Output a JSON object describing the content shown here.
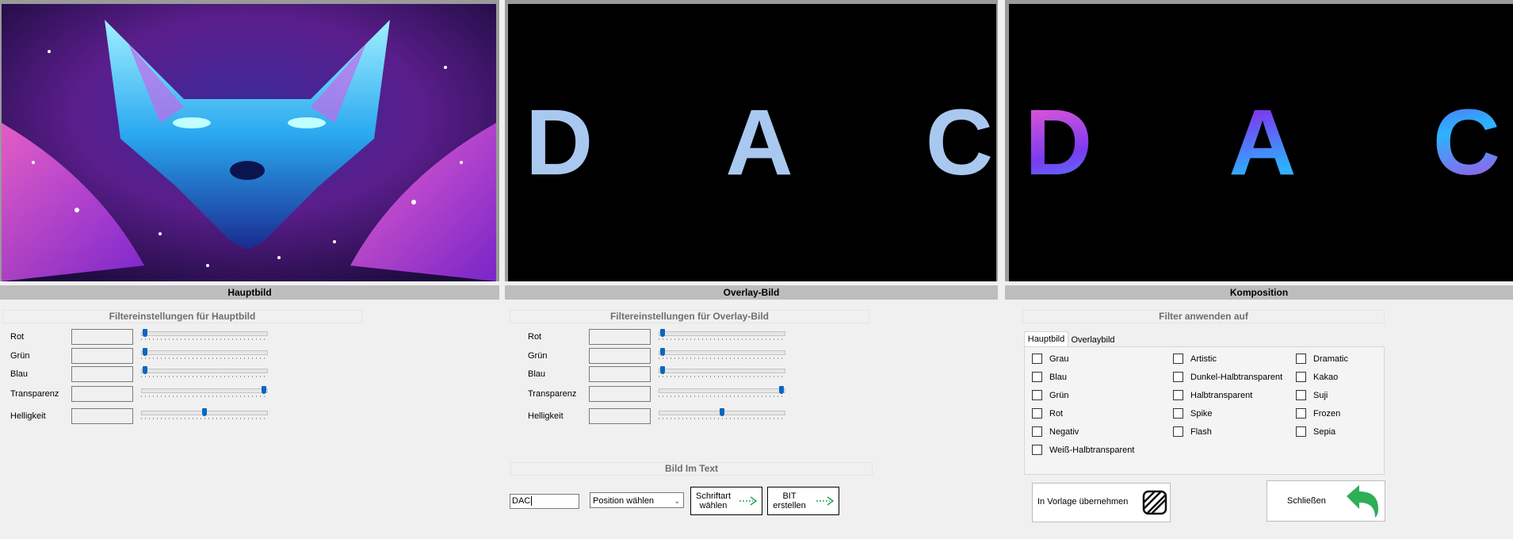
{
  "panels": {
    "main_caption": "Hauptbild",
    "overlay_caption": "Overlay-Bild",
    "composition_caption": "Komposition",
    "overlay_text": "DAC",
    "composition_text": "DAC"
  },
  "main_filter": {
    "header": "Filtereinstellungen für Hauptbild",
    "labels": [
      "Rot",
      "Grün",
      "Blau",
      "Transparenz",
      "Helligkeit"
    ],
    "levels": [
      0,
      0,
      0,
      1.0,
      0.5
    ]
  },
  "overlay_filter": {
    "header": "Filtereinstellungen für Overlay-Bild",
    "labels": [
      "Rot",
      "Grün",
      "Blau",
      "Transparenz",
      "Helligkeit"
    ],
    "levels": [
      0,
      0,
      0,
      1.0,
      0.5
    ]
  },
  "text_image": {
    "header": "Bild Im Text",
    "text_value": "DAC",
    "position_select": "Position wählen",
    "font_button": [
      "Schriftart",
      "wählen"
    ],
    "bit_button": [
      "BIT",
      "erstellen"
    ]
  },
  "apply_filter": {
    "header": "Filter anwenden auf",
    "tabs": [
      "Hauptbild",
      "Overlaybild"
    ],
    "active_tab": "Hauptbild",
    "col1": [
      "Grau",
      "Blau",
      "Grün",
      "Rot",
      "Negativ",
      "Weiß-Halbtransparent"
    ],
    "col2": [
      "Artistic",
      "Dunkel-Halbtransparent",
      "Halbtransparent",
      "Spike",
      "Flash"
    ],
    "col3": [
      "Dramatic",
      "Kakao",
      "Suji",
      "Frozen",
      "Sepia"
    ]
  },
  "actions": {
    "template_button": "In Vorlage übernehmen",
    "close_button": "Schließen"
  },
  "colors": {
    "slider_thumb": "#0a66c2",
    "arrow_green": "#22a55a",
    "overlay_letters": "#a9c8f0"
  }
}
